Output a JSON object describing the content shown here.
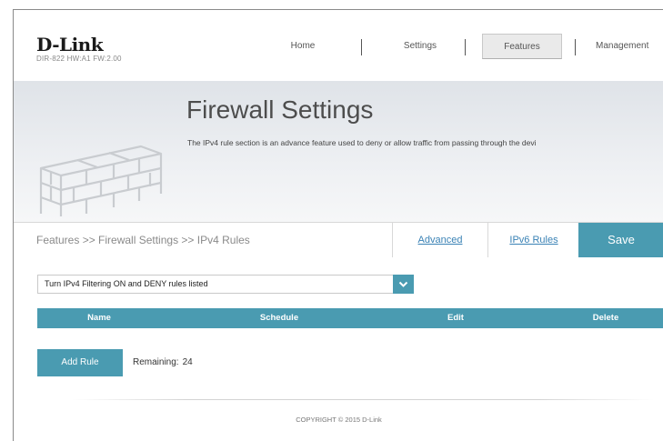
{
  "header": {
    "logo": "D-Link",
    "model": "DIR-822 HW:A1 FW:2.00",
    "nav": [
      {
        "label": "Home",
        "active": false
      },
      {
        "label": "Settings",
        "active": false
      },
      {
        "label": "Features",
        "active": true
      },
      {
        "label": "Management",
        "active": false
      }
    ]
  },
  "hero": {
    "title": "Firewall Settings",
    "description": "The IPv4 rule section is an advance feature used to deny or allow traffic from passing through the devi"
  },
  "tabbar": {
    "breadcrumb": "Features >> Firewall Settings >> IPv4 Rules",
    "tabs": [
      "Advanced",
      "IPv6 Rules"
    ],
    "save_label": "Save"
  },
  "filter": {
    "selected": "Turn IPv4 Filtering ON and DENY rules listed"
  },
  "table": {
    "columns": [
      "Name",
      "Schedule",
      "Edit",
      "Delete"
    ]
  },
  "rules": {
    "add_label": "Add Rule",
    "remaining_label": "Remaining:",
    "remaining_count": "24"
  },
  "footer": {
    "copyright": "COPYRIGHT © 2015 D-Link"
  },
  "colors": {
    "accent": "#4a9bb1",
    "link": "#3a82b5"
  }
}
